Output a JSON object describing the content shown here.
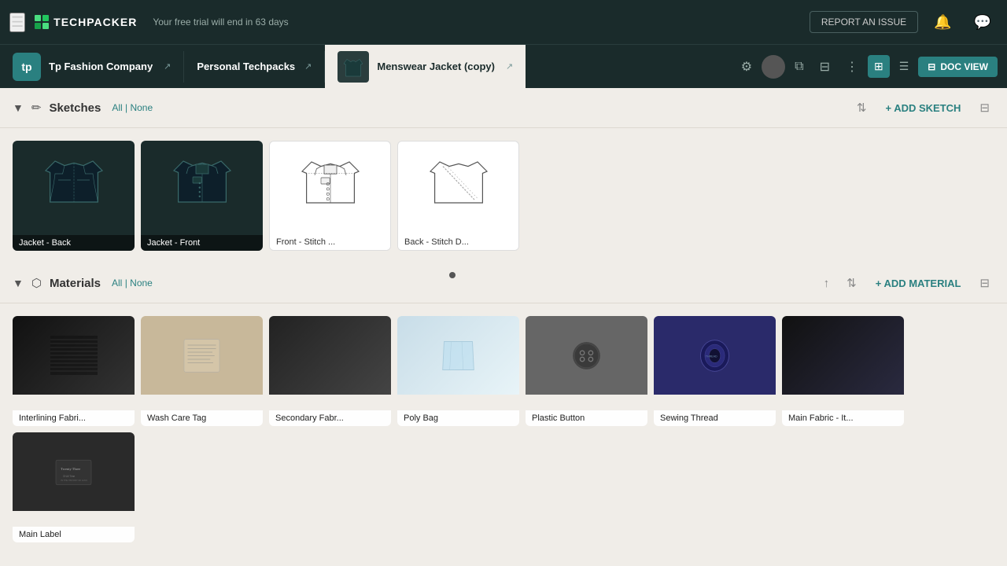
{
  "topnav": {
    "hamburger": "☰",
    "logo_text": "TECHPACKER",
    "trial_text": "Your free trial will end in 63 days",
    "report_btn": "REPORT AN ISSUE",
    "bell_icon": "🔔",
    "chat_icon": "💬"
  },
  "breadcrumb": {
    "tp_badge": "tp",
    "company_name": "Tp Fashion Company",
    "link_icon": "↗",
    "techpack_name": "Personal Techpacks",
    "jacket_name": "Menswear Jacket (copy)",
    "settings_icon": "⚙",
    "more_icon": "⋮",
    "layers_icon": "⊞",
    "doc_view": "DOC VIEW"
  },
  "sketches_section": {
    "title": "Sketches",
    "filter_all": "All",
    "filter_none": "None",
    "add_label": "+ ADD SKETCH",
    "items": [
      {
        "label": "Jacket - Back",
        "type": "dark"
      },
      {
        "label": "Jacket - Front",
        "type": "dark"
      },
      {
        "label": "Front - Stitch ...",
        "type": "light"
      },
      {
        "label": "Back - Stitch D...",
        "type": "light"
      }
    ]
  },
  "materials_section": {
    "title": "Materials",
    "filter_all": "All",
    "filter_none": "None",
    "add_label": "+ ADD MATERIAL",
    "items": [
      {
        "label": "Interlining Fabri...",
        "color_class": "mat-interlining"
      },
      {
        "label": "Wash Care Tag",
        "color_class": "mat-wash"
      },
      {
        "label": "Secondary Fabr...",
        "color_class": "mat-secondary"
      },
      {
        "label": "Poly Bag",
        "color_class": "mat-polybag"
      },
      {
        "label": "Plastic Button",
        "color_class": "mat-button"
      },
      {
        "label": "Sewing Thread",
        "color_class": "mat-thread"
      },
      {
        "label": "Main Fabric - It...",
        "color_class": "mat-main"
      },
      {
        "label": "Main Label",
        "color_class": "mat-label"
      }
    ]
  }
}
